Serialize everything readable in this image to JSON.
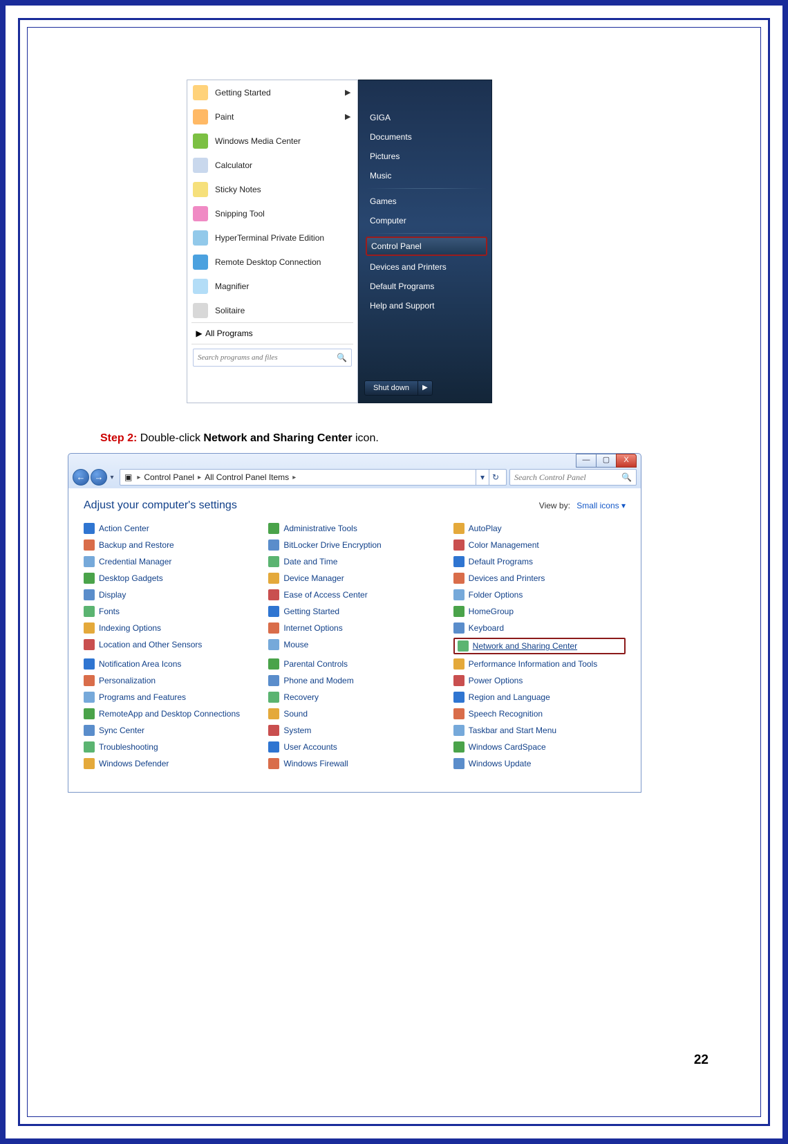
{
  "page_number": "22",
  "step2": {
    "label": "Step 2:",
    "pre_bold": " Double-click ",
    "bold": "Network and Sharing Center",
    "post_bold": " icon."
  },
  "start_menu": {
    "left_items": [
      {
        "label": "Getting Started",
        "submenu": true
      },
      {
        "label": "Paint",
        "submenu": true
      },
      {
        "label": "Windows Media Center",
        "submenu": false
      },
      {
        "label": "Calculator",
        "submenu": false
      },
      {
        "label": "Sticky Notes",
        "submenu": false
      },
      {
        "label": "Snipping Tool",
        "submenu": false
      },
      {
        "label": "HyperTerminal Private Edition",
        "submenu": false
      },
      {
        "label": "Remote Desktop Connection",
        "submenu": false
      },
      {
        "label": "Magnifier",
        "submenu": false
      },
      {
        "label": "Solitaire",
        "submenu": false
      }
    ],
    "all_programs": "All Programs",
    "search_placeholder": "Search programs and files",
    "right_items_top": [
      "GIGA",
      "Documents",
      "Pictures",
      "Music"
    ],
    "right_items_mid": [
      "Games",
      "Computer"
    ],
    "right_selected": "Control Panel",
    "right_items_bot": [
      "Devices and Printers",
      "Default Programs",
      "Help and Support"
    ],
    "shutdown_label": "Shut down"
  },
  "control_panel": {
    "win_buttons": [
      "—",
      "▢",
      "X"
    ],
    "breadcrumb": [
      "Control Panel",
      "All Control Panel Items"
    ],
    "search_placeholder": "Search Control Panel",
    "heading": "Adjust your computer's settings",
    "view_by_label": "View by:",
    "view_by_value": "Small icons ▾",
    "items_col1": [
      "Action Center",
      "Backup and Restore",
      "Credential Manager",
      "Desktop Gadgets",
      "Display",
      "Fonts",
      "Indexing Options",
      "Location and Other Sensors",
      "Notification Area Icons",
      "Personalization",
      "Programs and Features",
      "RemoteApp and Desktop Connections",
      "Sync Center",
      "Troubleshooting",
      "Windows Defender"
    ],
    "items_col2": [
      "Administrative Tools",
      "BitLocker Drive Encryption",
      "Date and Time",
      "Device Manager",
      "Ease of Access Center",
      "Getting Started",
      "Internet Options",
      "Mouse",
      "Parental Controls",
      "Phone and Modem",
      "Recovery",
      "Sound",
      "System",
      "User Accounts",
      "Windows Firewall"
    ],
    "items_col3": [
      "AutoPlay",
      "Color Management",
      "Default Programs",
      "Devices and Printers",
      "Folder Options",
      "HomeGroup",
      "Keyboard",
      "Network and Sharing Center",
      "Performance Information and Tools",
      "Power Options",
      "Region and Language",
      "Speech Recognition",
      "Taskbar and Start Menu",
      "Windows CardSpace",
      "Windows Update"
    ],
    "highlight_item": "Network and Sharing Center"
  }
}
